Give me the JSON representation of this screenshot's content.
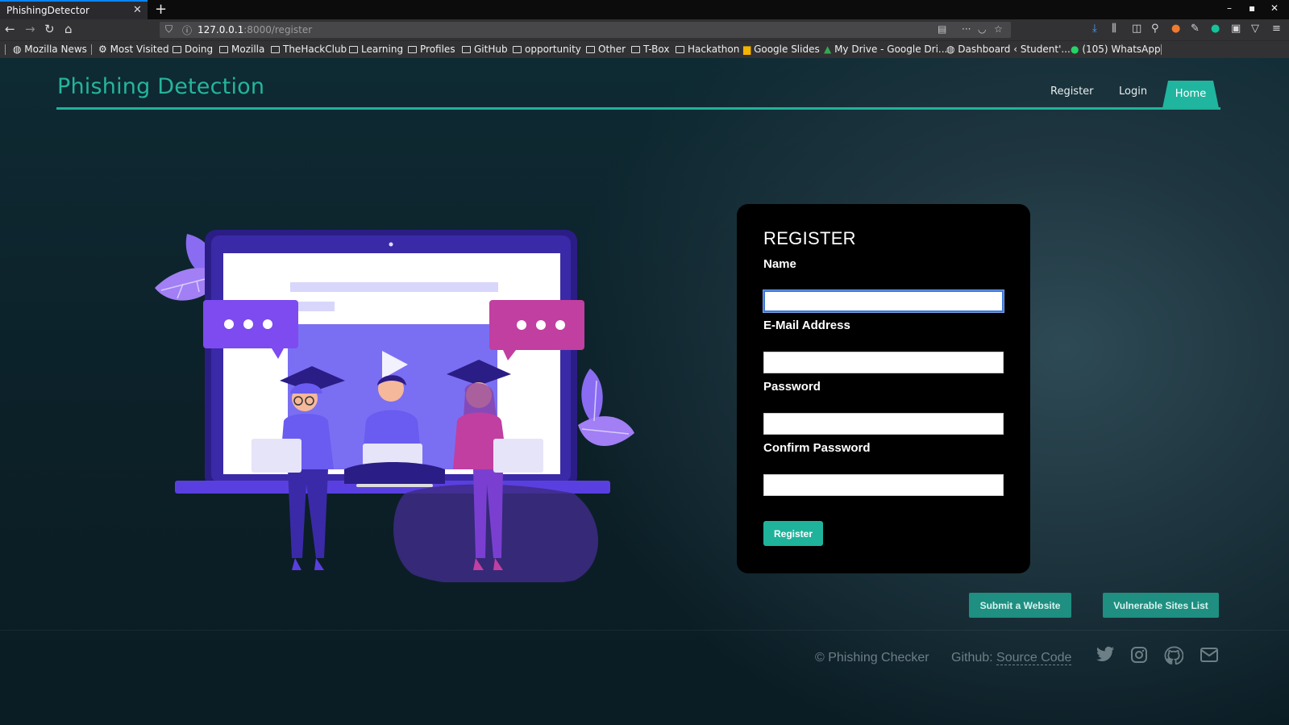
{
  "browser": {
    "tab_title": "PhishingDetector",
    "tab_close": "✕",
    "new_tab": "+",
    "url_host": "127.0.0.1",
    "url_path": ":8000/register",
    "bookmarks": [
      "Mozilla News",
      "Most Visited",
      "Doing",
      "Mozilla",
      "TheHackClub",
      "Learning",
      "Profiles",
      "GitHub",
      "opportunity",
      "Other",
      "T-Box",
      "Hackathon",
      "Google Slides",
      "My Drive - Google Dri...",
      "Dashboard ‹ Student'...",
      "(105) WhatsApp"
    ]
  },
  "header": {
    "brand": "Phishing Detection",
    "nav": {
      "register": "Register",
      "login": "Login",
      "home": "Home"
    }
  },
  "form": {
    "title": "REGISTER",
    "name_label": "Name",
    "email_label": "E-Mail Address",
    "password_label": "Password",
    "confirm_label": "Confirm Password",
    "name_value": "",
    "email_value": "",
    "password_value": "",
    "confirm_value": "",
    "submit": "Register"
  },
  "actions": {
    "submit_website": "Submit a Website",
    "vulnerable_list": "Vulnerable Sites List"
  },
  "footer": {
    "copyright": "© Phishing Checker",
    "github_prefix": "Github:",
    "github_link": "Source Code",
    "icons": [
      "twitter-icon",
      "instagram-icon",
      "github-icon",
      "mail-icon"
    ]
  },
  "colors": {
    "accent": "#1fb39b",
    "card": "#000000",
    "illustration_purple": "#6a5cf0",
    "illustration_pink": "#c13fa0"
  }
}
